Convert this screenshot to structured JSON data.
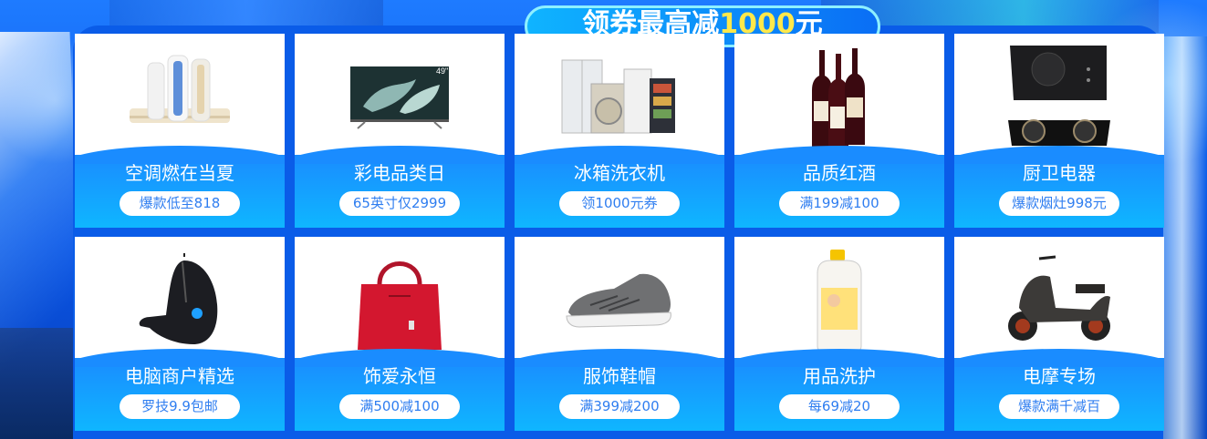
{
  "banner": {
    "text_main": "领券最高减",
    "text_highlight": "1000",
    "text_unit": "元"
  },
  "accent_color": "#0a5ce8",
  "cards": [
    {
      "title": "空调燃在当夏",
      "promo": "爆款低至818",
      "icon": "air-conditioner-icon"
    },
    {
      "title": "彩电品类日",
      "promo": "65英寸仅2999",
      "icon": "television-icon"
    },
    {
      "title": "冰箱洗衣机",
      "promo": "领1000元券",
      "icon": "fridge-washer-icon"
    },
    {
      "title": "品质红酒",
      "promo": "满199减100",
      "icon": "wine-bottles-icon"
    },
    {
      "title": "厨卫电器",
      "promo": "爆款烟灶998元",
      "icon": "range-hood-stove-icon"
    },
    {
      "title": "电脑商户精选",
      "promo": "罗技9.9包邮",
      "icon": "gaming-mouse-icon"
    },
    {
      "title": "饰爱永恒",
      "promo": "满500减100",
      "icon": "handbag-icon"
    },
    {
      "title": "服饰鞋帽",
      "promo": "满399减200",
      "icon": "sneaker-icon"
    },
    {
      "title": "用品洗护",
      "promo": "每69减20",
      "icon": "detergent-bottle-icon"
    },
    {
      "title": "电摩专场",
      "promo": "爆款满千减百",
      "icon": "electric-scooter-icon"
    }
  ],
  "tv_badge": "49\""
}
